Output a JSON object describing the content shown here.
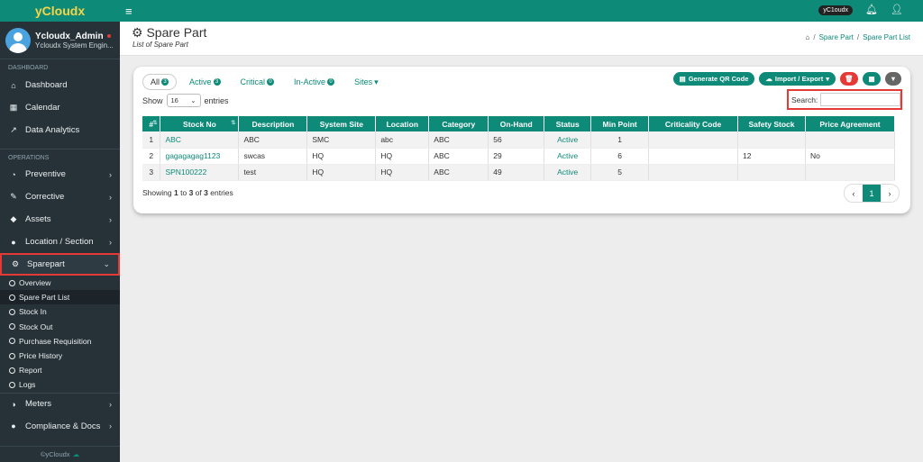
{
  "brand": "yCloudx",
  "user": {
    "name": "Ycloudx_Admin",
    "role": "Ycloudx System Engin..."
  },
  "sidebar": {
    "section_dashboard": "DASHBOARD",
    "dashboard_items": [
      {
        "label": "Dashboard",
        "icon": "home-icon"
      },
      {
        "label": "Calendar",
        "icon": "calendar-icon"
      },
      {
        "label": "Data Analytics",
        "icon": "chart-icon"
      }
    ],
    "section_operations": "OPERATIONS",
    "operations_items": [
      {
        "label": "Preventive"
      },
      {
        "label": "Corrective"
      },
      {
        "label": "Assets"
      },
      {
        "label": "Location / Section"
      },
      {
        "label": "Sparepart"
      }
    ],
    "sparepart_sub": [
      "Overview",
      "Spare Part List",
      "Stock In",
      "Stock Out",
      "Purchase Requisition",
      "Price History",
      "Report",
      "Logs"
    ],
    "after_items": [
      {
        "label": "Meters"
      },
      {
        "label": "Compliance & Docs"
      }
    ],
    "footer": "©yCloudx"
  },
  "topbar": {
    "badge": "yC1oudx"
  },
  "page": {
    "title": "Spare Part",
    "subtitle": "List of Spare Part",
    "breadcrumb": [
      "Spare Part",
      "Spare Part List"
    ]
  },
  "tabs": [
    {
      "label": "All",
      "count": "3"
    },
    {
      "label": "Active",
      "count": "3"
    },
    {
      "label": "Critical",
      "count": "0"
    },
    {
      "label": "In-Active",
      "count": "0"
    },
    {
      "label": "Sites",
      "count": ""
    }
  ],
  "toolbar": {
    "qr": "Generate QR Code",
    "import_export": "Import / Export"
  },
  "show": {
    "label_before": "Show",
    "value": "16",
    "label_after": "entries"
  },
  "search": {
    "label": "Search:"
  },
  "table": {
    "headers": [
      "#",
      "Stock No",
      "Description",
      "System Site",
      "Location",
      "Category",
      "On-Hand",
      "Status",
      "Min Point",
      "Criticality Code",
      "Safety Stock",
      "Price Agreement"
    ],
    "rows": [
      [
        "1",
        "ABC",
        "ABC",
        "SMC",
        "abc",
        "ABC",
        "56",
        "Active",
        "1",
        "",
        "",
        ""
      ],
      [
        "2",
        "gagagagag1123",
        "swcas",
        "HQ",
        "HQ",
        "ABC",
        "29",
        "Active",
        "6",
        "",
        "12",
        "No"
      ],
      [
        "3",
        "SPN100222",
        "test",
        "HQ",
        "HQ",
        "ABC",
        "49",
        "Active",
        "5",
        "",
        "",
        ""
      ]
    ]
  },
  "info": {
    "prefix": "Showing",
    "from": "1",
    "to_word": "to",
    "to": "3",
    "of_word": "of",
    "total": "3",
    "suffix": "entries"
  },
  "pager": {
    "page": "1"
  }
}
